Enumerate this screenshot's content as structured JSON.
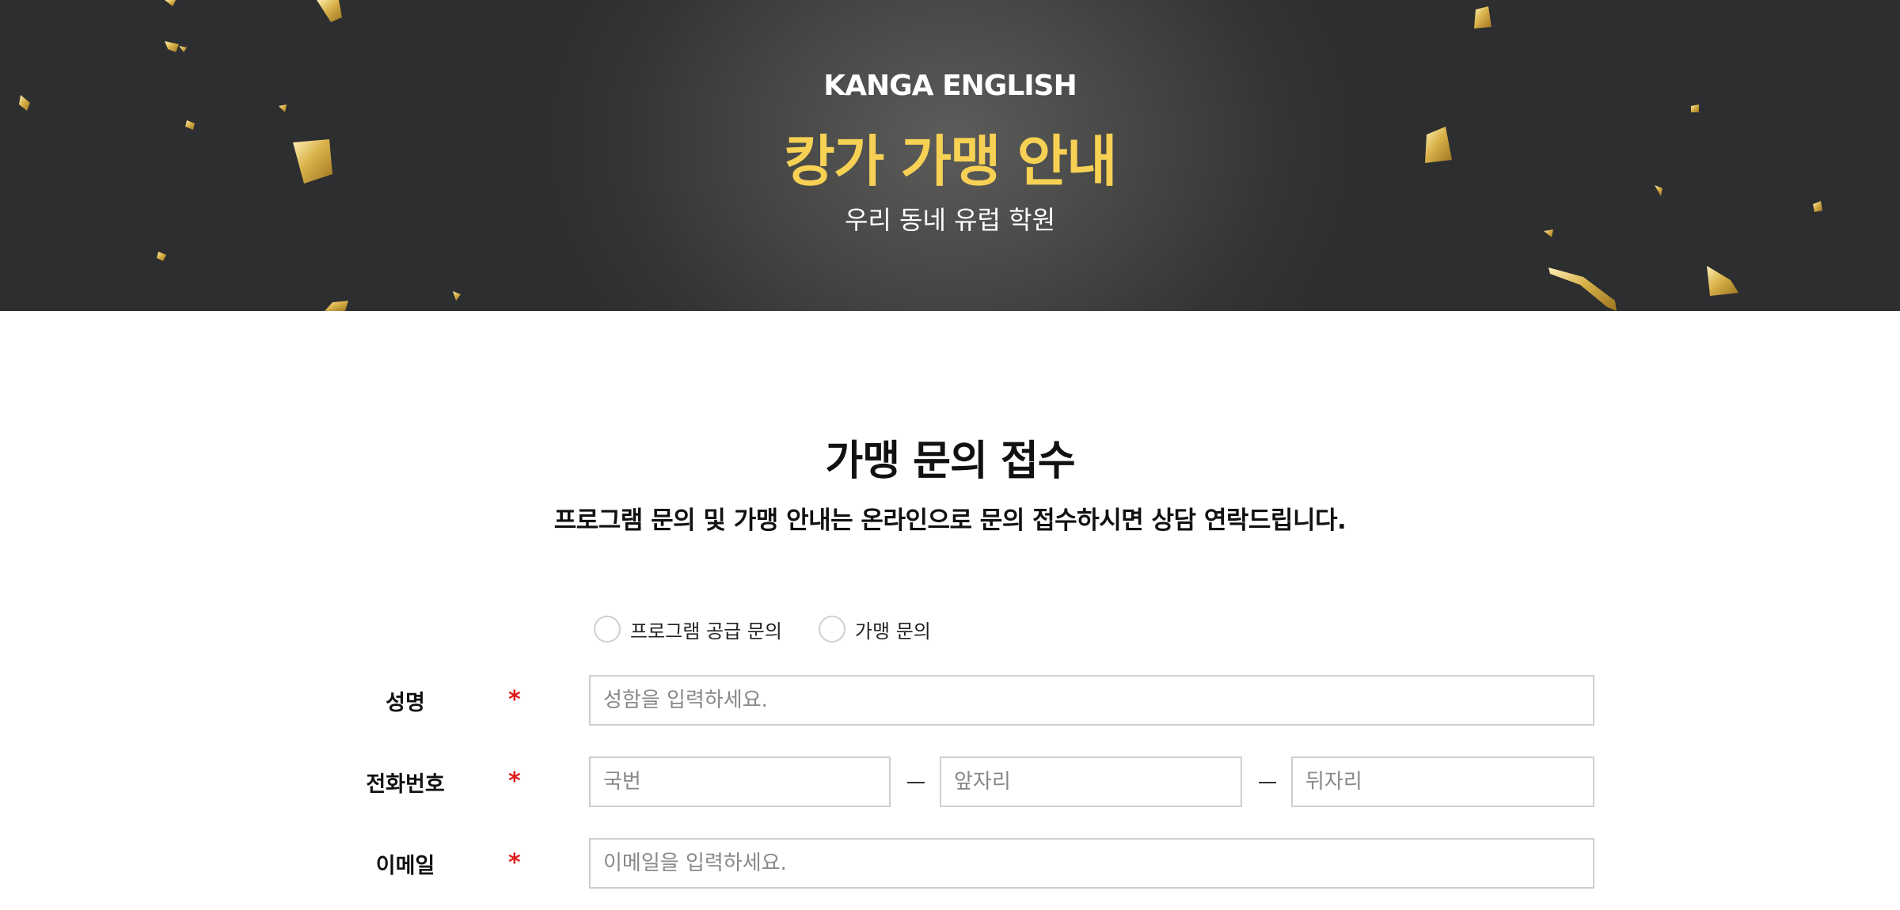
{
  "banner": {
    "brand": "KANGA ENGLISH",
    "headline": "캉가 가맹 안내",
    "tagline": "우리 동네 유럽 학원"
  },
  "inquiry": {
    "title": "가맹 문의 접수",
    "description": "프로그램 문의 및 가맹 안내는 온라인으로 문의 접수하시면 상담 연락드립니다.",
    "types": [
      {
        "label": "프로그램 공급 문의"
      },
      {
        "label": "가맹 문의"
      }
    ]
  },
  "form": {
    "required_mark": "*",
    "name": {
      "label": "성명",
      "placeholder": "성함을 입력하세요."
    },
    "phone": {
      "label": "전화번호",
      "area_placeholder": "국번",
      "front_placeholder": "앞자리",
      "back_placeholder": "뒤자리"
    },
    "email": {
      "label": "이메일",
      "placeholder": "이메일을 입력하세요."
    }
  },
  "colors": {
    "headline": "#f7d154",
    "required": "#e01b1b",
    "confetti_gold": "#d9b24a"
  }
}
